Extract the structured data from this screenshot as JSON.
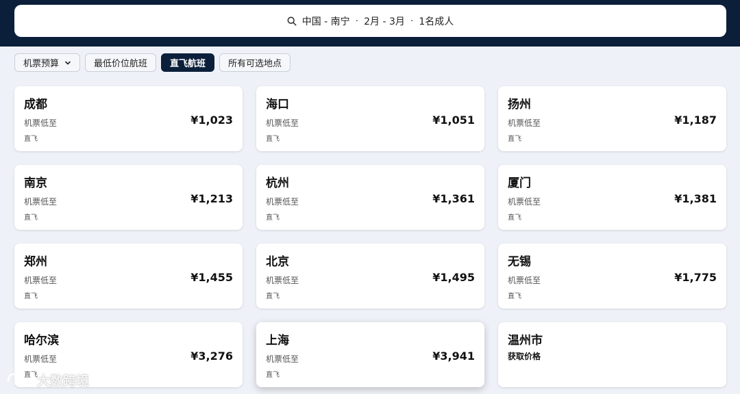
{
  "search": {
    "origin_dest": "中国 - 南宁",
    "dates": "2月 - 3月",
    "travelers": "1名成人",
    "separator": "·"
  },
  "filters": [
    {
      "label": "机票预算",
      "active": false,
      "dropdown": true
    },
    {
      "label": "最低价位航班",
      "active": false
    },
    {
      "label": "直飞航班",
      "active": true
    },
    {
      "label": "所有可选地点",
      "active": false
    }
  ],
  "cards": [
    {
      "city": "成都",
      "from_label": "机票低至",
      "price": "¥1,023",
      "type": "直飞"
    },
    {
      "city": "海口",
      "from_label": "机票低至",
      "price": "¥1,051",
      "type": "直飞"
    },
    {
      "city": "扬州",
      "from_label": "机票低至",
      "price": "¥1,187",
      "type": "直飞"
    },
    {
      "city": "南京",
      "from_label": "机票低至",
      "price": "¥1,213",
      "type": "直飞"
    },
    {
      "city": "杭州",
      "from_label": "机票低至",
      "price": "¥1,361",
      "type": "直飞"
    },
    {
      "city": "厦门",
      "from_label": "机票低至",
      "price": "¥1,381",
      "type": "直飞"
    },
    {
      "city": "郑州",
      "from_label": "机票低至",
      "price": "¥1,455",
      "type": "直飞"
    },
    {
      "city": "北京",
      "from_label": "机票低至",
      "price": "¥1,495",
      "type": "直飞"
    },
    {
      "city": "无锡",
      "from_label": "机票低至",
      "price": "¥1,775",
      "type": "直飞"
    },
    {
      "city": "哈尔滨",
      "from_label": "机票低至",
      "price": "¥3,276",
      "type": "直飞"
    },
    {
      "city": "上海",
      "from_label": "机票低至",
      "price": "¥3,941",
      "type": "直飞"
    },
    {
      "city": "温州市",
      "loading": "获取价格"
    }
  ],
  "watermark": {
    "text": "大数跨境"
  },
  "colors": {
    "header": "#0b1f3a",
    "active_chip": "#0b1f3a",
    "page_bg": "#eef1f7"
  }
}
